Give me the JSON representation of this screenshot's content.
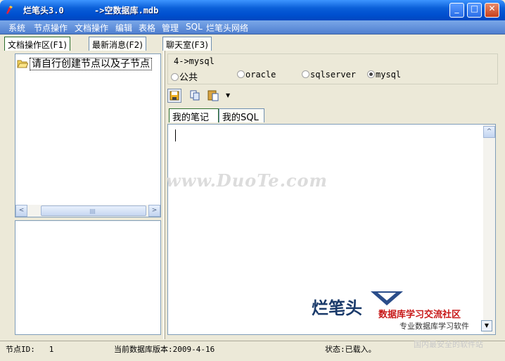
{
  "window": {
    "title": "烂笔头3.0      ->空数据库.mdb",
    "minimize_label": "_",
    "maximize_label": "□",
    "close_label": "✕"
  },
  "menu": [
    "系统",
    "节点操作",
    "文档操作",
    "编辑",
    "表格",
    "管理",
    "SQL",
    "烂笔头网络"
  ],
  "top_tabs": [
    "文档操作区(F1)",
    "最新消息(F2)",
    "聊天室(F3)"
  ],
  "tree": {
    "node_label": "请自行创建节点以及子节点"
  },
  "scrollbar": {
    "left_arrow": "<",
    "right_arrow": ">",
    "up_arrow": "^"
  },
  "db": {
    "path": "4->mysql",
    "options": [
      "公共",
      "oracle",
      "sqlserver",
      "mysql"
    ],
    "selected": "mysql"
  },
  "note_tabs": [
    "我的笔记",
    "我的SQL"
  ],
  "watermark": "www.DuoTe.com",
  "logo": {
    "name": "烂笔头",
    "tagline": "数据库学习交流社区",
    "subtitle": "专业数据库学习软件"
  },
  "status": {
    "node_id": "节点ID:   1",
    "db_version": "当前数据库版本:2009-4-16",
    "state": "状态:已载入。"
  },
  "footer_watermark": "国内最安全的软件站",
  "colors": {
    "titlebar": "#0a5fd8",
    "menubar": "#5f8fd8",
    "window_bg": "#ece9d8"
  }
}
